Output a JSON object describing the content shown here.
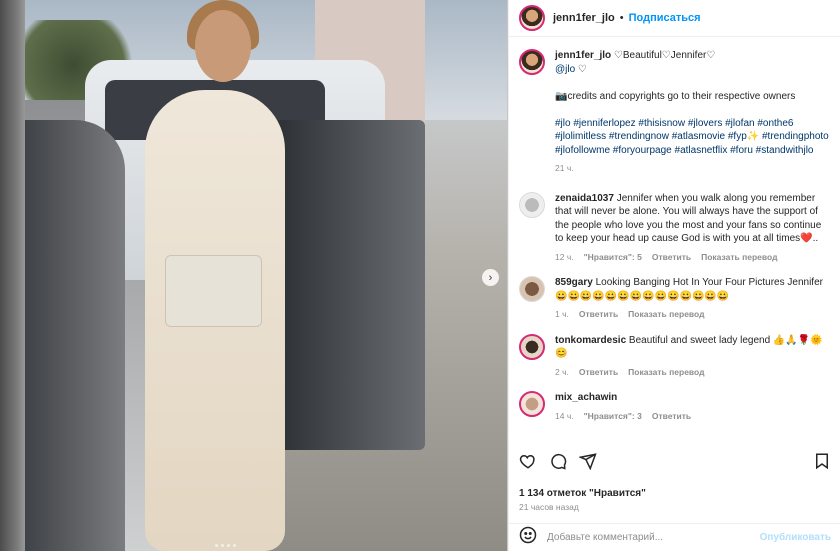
{
  "colors": {
    "accent": "#0095f6",
    "link": "#00376b",
    "muted": "#8e8e8e",
    "text": "#262626",
    "heart": "#ed4956"
  },
  "header": {
    "username": "jenn1fer_jlo",
    "follow_label": "Подписаться"
  },
  "caption": {
    "username": "jenn1fer_jlo",
    "line1": "♡Beautiful♡Jennifer♡",
    "mention": "@jlo",
    "mention_suffix": " ♡",
    "credits": "📷credits and copyrights go to their respective owners",
    "hashtags": "#jlo #jenniferlopez #thisisnow #jlovers #jlofan #onthe6 #jlolimitless #trendingnow #atlasmovie #fyp✨ #trendingphoto #jlofollowme #foryourpage #atlasnetflix #foru #standwithjlo",
    "time": "21 ч."
  },
  "comments": [
    {
      "username": "zenaida1037",
      "text": "Jennifer when you walk along you remember that will never be alone. You will always have the support of the people who love you the most and your fans so continue to keep your head up cause God is with you at all times❤️..",
      "time": "12 ч.",
      "likes": "\"Нравится\": 5",
      "reply": "Ответить",
      "translate": "Показать перевод"
    },
    {
      "username": "859gary",
      "text": "Looking Banging Hot In Your Four Pictures Jennifer 😀😀😀😀😀😀😀😀😀😀😀😀😀😀",
      "time": "1 ч.",
      "reply": "Ответить",
      "translate": "Показать перевод"
    },
    {
      "username": "tonkomardesic",
      "text": "Beautiful and sweet lady legend 👍🙏🌹🌞😊",
      "time": "2 ч.",
      "reply": "Ответить",
      "translate": "Показать перевод"
    },
    {
      "username": "mix_achawin",
      "text": "",
      "time": "14 ч.",
      "likes": "\"Нравится\": 3",
      "reply": "Ответить"
    }
  ],
  "likes_count": "1 134 отметок \"Нравится\"",
  "post_time": "21 часов назад",
  "add_comment": {
    "placeholder": "Добавьте комментарий...",
    "publish": "Опубликовать"
  },
  "icons": [
    "heart-icon",
    "comment-icon",
    "share-icon",
    "bookmark-icon",
    "emoji-icon",
    "next-arrow-icon"
  ]
}
